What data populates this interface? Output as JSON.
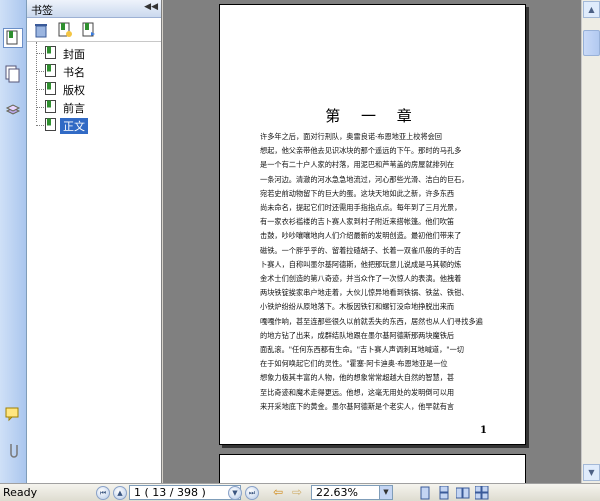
{
  "bookmarks": {
    "title": "书签",
    "collapse_icon": "double-left-arrow",
    "toolbar": [
      "delete-icon",
      "new-bookmark-icon",
      "bookmark-properties-icon"
    ],
    "items": [
      {
        "label": "封面",
        "selected": false
      },
      {
        "label": "书名",
        "selected": false
      },
      {
        "label": "版权",
        "selected": false
      },
      {
        "label": "前言",
        "selected": false
      },
      {
        "label": "正文",
        "selected": true
      }
    ]
  },
  "left_strip": [
    "bookmarks-icon",
    "pages-icon",
    "layers-icon",
    "comments-icon",
    "attachments-icon"
  ],
  "document": {
    "chapter_title": "第 一 章",
    "body_lines": [
      "许多年之后，面对行刑队，奥雷良诺·布恩地亚上校将会回",
      "想起，他父亲带他去见识冰块的那个遥远的下午。那时的马孔多",
      "是一个有二十户人家的村落，用泥巴和芦苇盖的房屋就排列在",
      "一条河边。清澈的河水急急地流过，河心那些光滑、洁白的巨石，",
      "宛若史前动物留下的巨大的蛋。这块天地如此之新，许多东西",
      "尚未命名，提起它们时还需用手指指点点。每年到了三月光景，",
      "有一家衣衫褴褛的吉卜赛人家到村子附近来搭帐篷。他们吹笛",
      "击鼓，吵吵嚷嚷地向人们介绍最新的发明创造。最初他们带来了",
      "磁铁。一个胖乎乎的、留着拉碴胡子、长着一双雀爪般的手的吉",
      "卜赛人，自称叫墨尔基阿德斯，他把那玩意儿说成是马其顿的炼",
      "金术士们创造的第八奇迹，并当众作了一次惊人的表演。他拽着",
      "两块铁锭挨家串户地走着，大伙儿惊异地看到铁锅、铁盆、铁钳、",
      "小铁炉纷纷从原地落下。木板因铁钉和螺钉没命地挣脱出来而",
      "嘎嘎作响，甚至连那些很久以前就丢失的东西，居然也从人们寻找多遍",
      "的地方钻了出来，成群结队地跟在墨尔基阿德斯那两块魔铁后",
      "面乱滚。\"任何东西都有生命。\"吉卜赛人声调刺耳地喊道，\"一切",
      "在于如何唤起它们的灵性。\"霍塞·阿卡迪奥·布恩地亚是一位",
      "想象力极其丰富的人物，他的想象常常超越大自然的智慧，甚",
      "至比奇迹和魔术走得更远。他想，这毫无用处的发明倒可以用",
      "来开采地底下的黄金。墨尔基阿德斯是个老实人，他早就有言"
    ],
    "page_number": "1"
  },
  "statusbar": {
    "status": "Ready",
    "page_field": "1  ( 13 / 398 )",
    "zoom": "22.63%"
  },
  "colors": {
    "doc_background": "#808080",
    "selected": "#316ac5",
    "strip": "#aac6ee"
  }
}
